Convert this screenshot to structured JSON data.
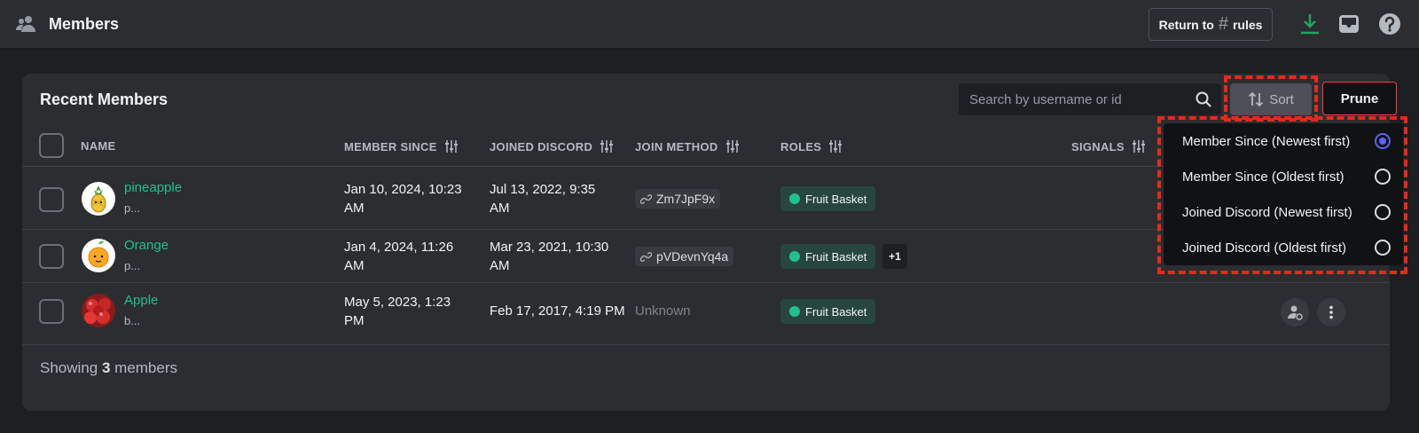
{
  "header": {
    "title": "Members",
    "return_label": "Return to",
    "return_hash": "#",
    "return_channel": "rules"
  },
  "panel": {
    "title": "Recent Members",
    "search_placeholder": "Search by username or id",
    "sort_label": "Sort",
    "prune_label": "Prune"
  },
  "table": {
    "columns": {
      "name": "NAME",
      "member_since": "MEMBER SINCE",
      "joined_discord": "JOINED DISCORD",
      "join_method": "JOIN METHOD",
      "roles": "ROLES",
      "signals": "SIGNALS"
    },
    "rows": [
      {
        "name": "pineapple",
        "sub": "p...",
        "member_since_1": "Jan 10, 2024, 10:23",
        "member_since_2": "AM",
        "joined_1": "Jul 13, 2022, 9:35",
        "joined_2": "AM",
        "join_method": "Zm7JpF9x",
        "role": "Fruit Basket",
        "extra_roles": ""
      },
      {
        "name": "Orange",
        "sub": "p...",
        "member_since_1": "Jan 4, 2024, 11:26",
        "member_since_2": "AM",
        "joined_1": "Mar 23, 2021, 10:30",
        "joined_2": "AM",
        "join_method": "pVDevnYq4a",
        "role": "Fruit Basket",
        "extra_roles": "+1"
      },
      {
        "name": "Apple",
        "sub": "b...",
        "member_since_1": "May 5, 2023, 1:23",
        "member_since_2": "PM",
        "joined_1": "Feb 17, 2017, 4:19 PM",
        "joined_2": "",
        "join_method": "Unknown",
        "role": "Fruit Basket",
        "extra_roles": ""
      }
    ]
  },
  "footer": {
    "prefix": "Showing",
    "count": "3",
    "suffix": "members"
  },
  "sort_menu": {
    "options": [
      {
        "label": "Member Since (Newest first)",
        "selected": true
      },
      {
        "label": "Member Since (Oldest first)",
        "selected": false
      },
      {
        "label": "Joined Discord (Newest first)",
        "selected": false
      },
      {
        "label": "Joined Discord (Oldest first)",
        "selected": false
      }
    ]
  },
  "colors": {
    "accent_green": "#23c08d",
    "blurple": "#5865f2",
    "danger": "#f23f42",
    "highlight_dash": "#e52a1a"
  }
}
